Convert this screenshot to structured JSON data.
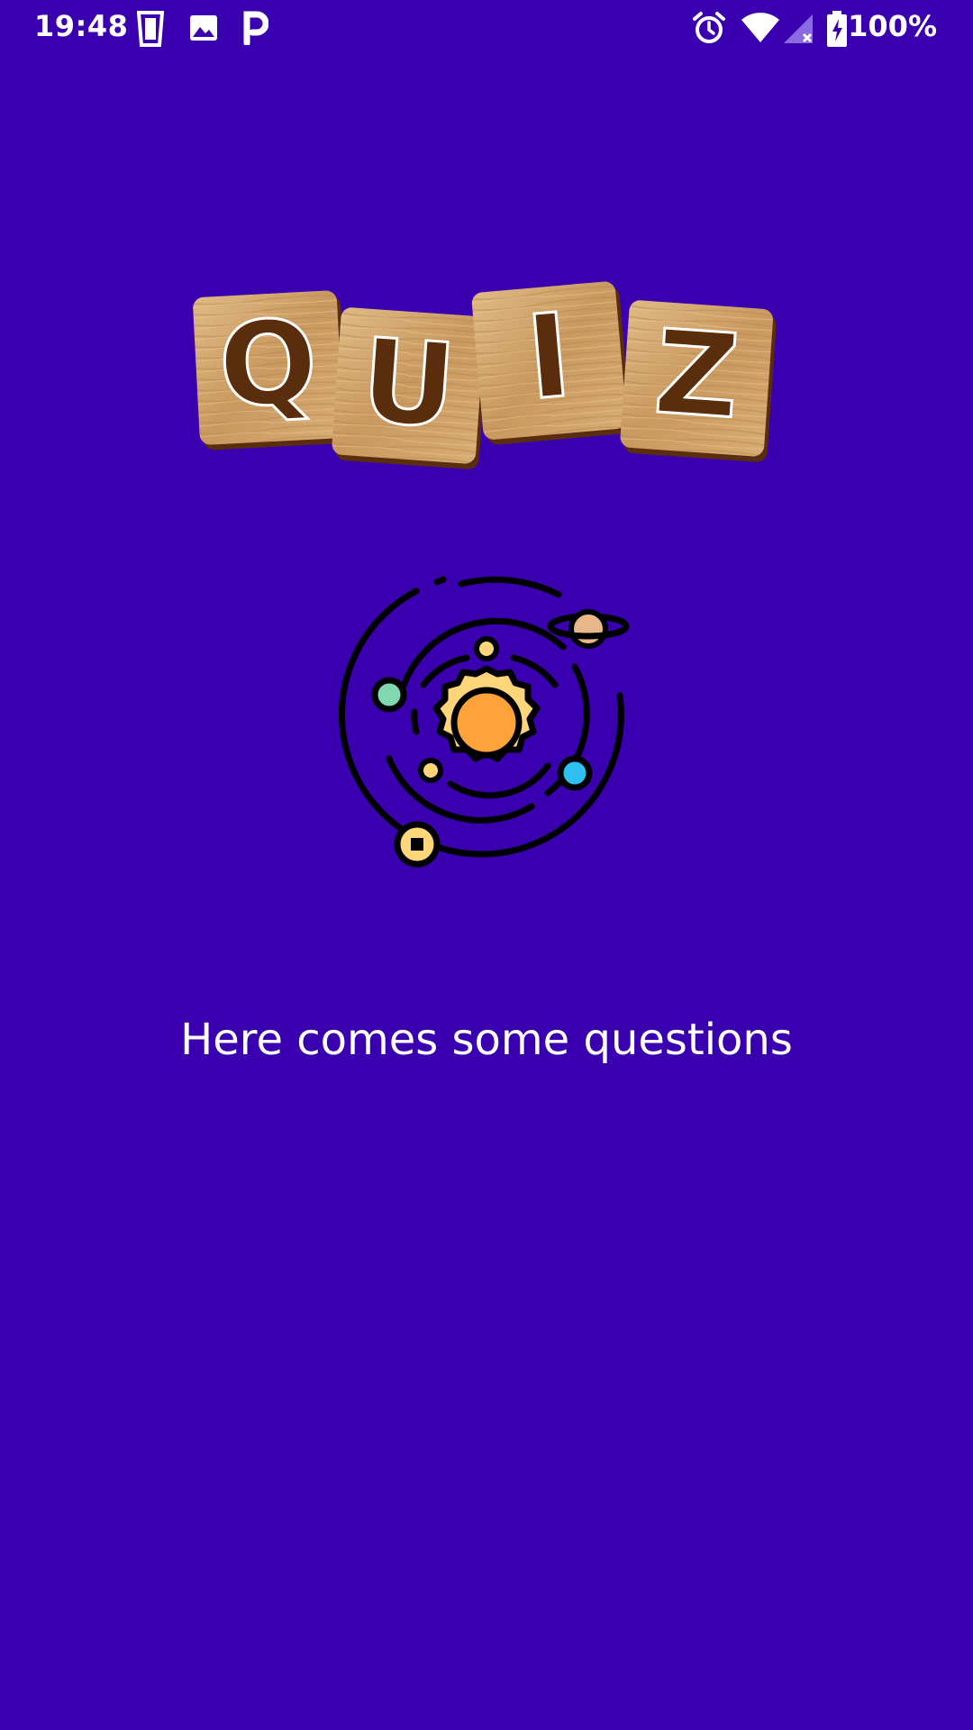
{
  "status_bar": {
    "time": "19:48",
    "battery": "100%",
    "icons": [
      "cup-icon",
      "image-icon",
      "parking-icon",
      "alarm-icon",
      "wifi-icon",
      "signal-icon",
      "battery-icon"
    ]
  },
  "logo": {
    "letters": [
      "Q",
      "U",
      "I",
      "Z"
    ]
  },
  "illustration": {
    "icon": "solar-system-icon"
  },
  "main": {
    "tagline": "Here comes some questions"
  },
  "colors": {
    "background": "#3a00b0",
    "tile": "#d2a56f",
    "letter": "#5a2e0c",
    "sun": "#ffa23a",
    "planet_yellow": "#ffd57a",
    "planet_green": "#7fd8b0",
    "planet_blue": "#2ec0f0"
  }
}
